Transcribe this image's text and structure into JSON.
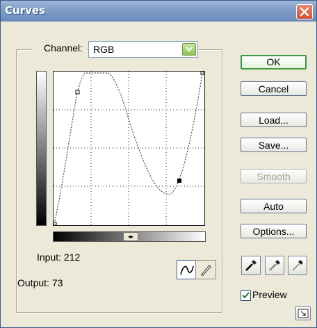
{
  "window": {
    "title": "Curves"
  },
  "channel": {
    "label": "Channel:",
    "value": "RGB"
  },
  "readout": {
    "input_label": "Input:",
    "input_value": "212",
    "output_label": "Output:",
    "output_value": "73"
  },
  "buttons": {
    "ok": "OK",
    "cancel": "Cancel",
    "load": "Load...",
    "save": "Save...",
    "smooth": "Smooth",
    "auto": "Auto",
    "options": "Options..."
  },
  "preview": {
    "label": "Preview",
    "checked": true
  },
  "icons": {
    "close": "close-icon",
    "dropdown": "chevron-down-icon",
    "curve_tool": "curve-tool-icon",
    "pencil_tool": "pencil-tool-icon",
    "black_eyedropper": "black-eyedropper-icon",
    "gray_eyedropper": "gray-eyedropper-icon",
    "white_eyedropper": "white-eyedropper-icon",
    "expand": "expand-icon"
  },
  "colors": {
    "title_bar": "#7f9cc8",
    "close_button": "#d2512c",
    "default_button_border": "#3d9a3d",
    "dialog_bg": "#ece9d8"
  }
}
